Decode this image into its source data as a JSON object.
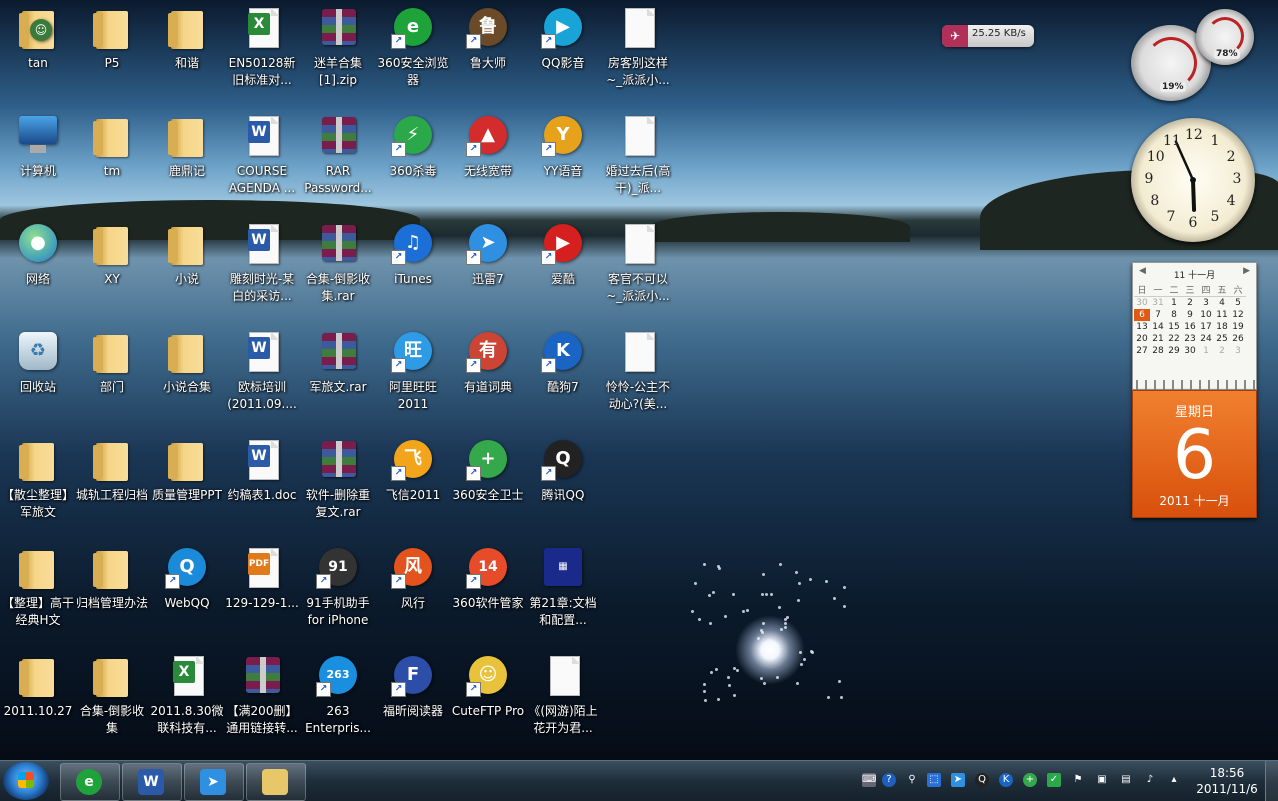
{
  "desktop_icons": [
    {
      "label": "tan",
      "type": "user"
    },
    {
      "label": "P5",
      "type": "folder"
    },
    {
      "label": "和谐",
      "type": "folder"
    },
    {
      "label": "EN50128新旧标准对...",
      "type": "excel"
    },
    {
      "label": "迷羊合集[1].zip",
      "type": "rar"
    },
    {
      "label": "360安全浏览器",
      "type": "app",
      "color": "#1ea33b",
      "glyph": "e"
    },
    {
      "label": "鲁大师",
      "type": "app",
      "color": "#6b4a2a",
      "glyph": "鲁"
    },
    {
      "label": "QQ影音",
      "type": "app",
      "color": "#19a4d8",
      "glyph": "▶"
    },
    {
      "label": "房客别这样~_派派小...",
      "type": "txt"
    },
    {
      "label": "计算机",
      "type": "computer"
    },
    {
      "label": "tm",
      "type": "folder"
    },
    {
      "label": "鹿鼎记",
      "type": "folder"
    },
    {
      "label": "COURSE AGENDA ...",
      "type": "word"
    },
    {
      "label": "RAR Password...",
      "type": "rar"
    },
    {
      "label": "360杀毒",
      "type": "app",
      "color": "#2aa84a",
      "glyph": "⚡"
    },
    {
      "label": "无线宽带",
      "type": "app",
      "color": "#d42c2c",
      "glyph": "▲"
    },
    {
      "label": "YY语音",
      "type": "app",
      "color": "#e7a21b",
      "glyph": "Y"
    },
    {
      "label": "婚过去后(高干)_派...",
      "type": "txt"
    },
    {
      "label": "网络",
      "type": "network"
    },
    {
      "label": "XY",
      "type": "folder"
    },
    {
      "label": "小说",
      "type": "folder"
    },
    {
      "label": "雕刻时光-某白的采访...",
      "type": "word"
    },
    {
      "label": "合集-倒影收集.rar",
      "type": "rar"
    },
    {
      "label": "iTunes",
      "type": "app",
      "color": "#1b6fd6",
      "glyph": "♫"
    },
    {
      "label": "迅雷7",
      "type": "app",
      "color": "#2f8fe0",
      "glyph": "➤"
    },
    {
      "label": "爱酷",
      "type": "app",
      "color": "#d62020",
      "glyph": "▶"
    },
    {
      "label": "客官不可以~_派派小...",
      "type": "txt"
    },
    {
      "label": "回收站",
      "type": "recycle"
    },
    {
      "label": "部门",
      "type": "folder"
    },
    {
      "label": "小说合集",
      "type": "folder"
    },
    {
      "label": "欧标培训(2011.09....",
      "type": "word"
    },
    {
      "label": "军旅文.rar",
      "type": "rar"
    },
    {
      "label": "阿里旺旺2011",
      "type": "app",
      "color": "#2f9be4",
      "glyph": "旺"
    },
    {
      "label": "有道词典",
      "type": "app",
      "color": "#c43",
      "glyph": "有"
    },
    {
      "label": "酷狗7",
      "type": "app",
      "color": "#1a64c4",
      "glyph": "K"
    },
    {
      "label": "怜怜-公主不动心?(美...",
      "type": "txt"
    },
    {
      "label": "【散尘整理】军旅文",
      "type": "folder"
    },
    {
      "label": "城轨工程归档",
      "type": "folder"
    },
    {
      "label": "质量管理PPT",
      "type": "folder"
    },
    {
      "label": "约稿表1.doc",
      "type": "word"
    },
    {
      "label": "软件-删除重复文.rar",
      "type": "rar"
    },
    {
      "label": "飞信2011",
      "type": "app",
      "color": "#f2a51a",
      "glyph": "飞"
    },
    {
      "label": "360安全卫士",
      "type": "app",
      "color": "#34a84a",
      "glyph": "+"
    },
    {
      "label": "腾讯QQ",
      "type": "app",
      "color": "#222",
      "glyph": "Q"
    },
    {
      "label": "【整理】高干经典H文",
      "type": "folder"
    },
    {
      "label": "归档管理办法",
      "type": "folder"
    },
    {
      "label": "WebQQ",
      "type": "app",
      "color": "#1b8ad8",
      "glyph": "Q"
    },
    {
      "label": "129-129-1...",
      "type": "pdf"
    },
    {
      "label": "91手机助手 for iPhone",
      "type": "app",
      "color": "#333",
      "glyph": "91"
    },
    {
      "label": "风行",
      "type": "app",
      "color": "#e2531d",
      "glyph": "风"
    },
    {
      "label": "360软件管家",
      "type": "app",
      "color": "#e64b2a",
      "glyph": "14"
    },
    {
      "label": "第21章:文档和配置...",
      "type": "video"
    },
    {
      "label": "2011.10.27",
      "type": "folder"
    },
    {
      "label": "合集-倒影收集",
      "type": "folder"
    },
    {
      "label": "2011.8.30微联科技有...",
      "type": "excel"
    },
    {
      "label": "【满200删】通用链接转...",
      "type": "rar"
    },
    {
      "label": "263 Enterpris...",
      "type": "app",
      "color": "#1a8fe0",
      "glyph": "263"
    },
    {
      "label": "福昕阅读器",
      "type": "app",
      "color": "#2c4ea8",
      "glyph": "F"
    },
    {
      "label": "CuteFTP Pro",
      "type": "app",
      "color": "#e8c23a",
      "glyph": "☺"
    },
    {
      "label": "《(网游)陌上花开为君...",
      "type": "txt"
    }
  ],
  "gadgets": {
    "net_speed": "25.25 KB/s",
    "cpu_pct": "19%",
    "mem_pct": "78%",
    "clock": {
      "hour": 5,
      "minute": 56
    },
    "calendar": {
      "month_label": "11 十一月",
      "weekdays": [
        "日",
        "一",
        "二",
        "三",
        "四",
        "五",
        "六"
      ],
      "weeks": [
        [
          "30",
          "31",
          "1",
          "2",
          "3",
          "4",
          "5"
        ],
        [
          "6",
          "7",
          "8",
          "9",
          "10",
          "11",
          "12"
        ],
        [
          "13",
          "14",
          "15",
          "16",
          "17",
          "18",
          "19"
        ],
        [
          "20",
          "21",
          "22",
          "23",
          "24",
          "25",
          "26"
        ],
        [
          "27",
          "28",
          "29",
          "30",
          "1",
          "2",
          "3"
        ]
      ],
      "today": "6"
    },
    "day_card": {
      "weekday": "星期日",
      "day": "6",
      "year_month": "2011 十一月"
    }
  },
  "taskbar": {
    "items": [
      "360安全浏览器",
      "Microsoft Word",
      "迅雷",
      "Windows Explorer"
    ],
    "time": "18:56",
    "date": "2011/11/6"
  }
}
